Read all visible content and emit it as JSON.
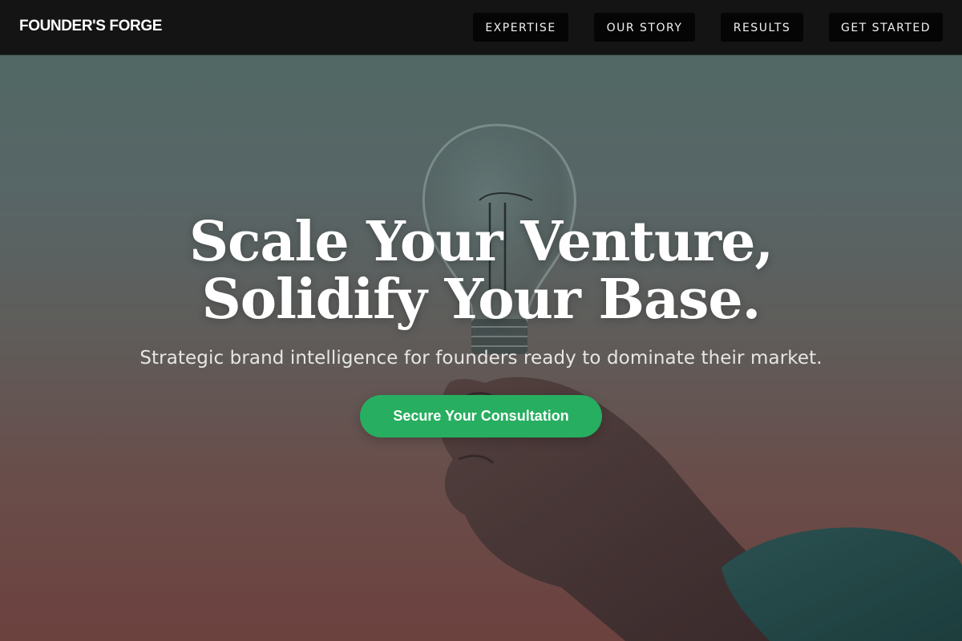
{
  "brand": {
    "name": "FOUNDER'S FORGE"
  },
  "nav": {
    "items": [
      {
        "label": "EXPERTISE"
      },
      {
        "label": "OUR STORY"
      },
      {
        "label": "RESULTS"
      },
      {
        "label": "GET STARTED"
      }
    ]
  },
  "hero": {
    "headline_line1": "Scale Your Venture,",
    "headline_line2": "Solidify Your Base.",
    "subheadline": "Strategic brand intelligence for founders ready to dominate their market.",
    "cta_label": "Secure Your Consultation",
    "image_subject": "hand-holding-lightbulb"
  },
  "colors": {
    "nav_background": "#141414",
    "nav_button_background": "#050505",
    "cta_green": "#27ae60",
    "text_white": "#ffffff"
  }
}
